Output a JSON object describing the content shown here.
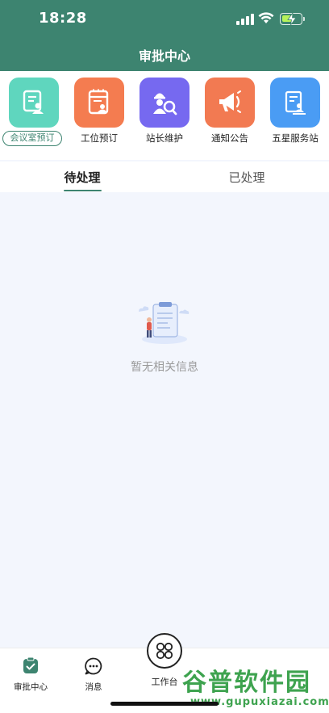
{
  "status_bar": {
    "time": "18:28"
  },
  "header": {
    "title": "审批中心"
  },
  "shortcuts": [
    {
      "label": "会议室预订",
      "icon": "meeting-room-icon",
      "color": "#5fd6be"
    },
    {
      "label": "工位预订",
      "icon": "workstation-icon",
      "color": "#f47c50"
    },
    {
      "label": "站长维护",
      "icon": "station-manager-icon",
      "color": "#7669f0"
    },
    {
      "label": "通知公告",
      "icon": "announcement-icon",
      "color": "#f27a52"
    },
    {
      "label": "五星服务站",
      "icon": "service-station-icon",
      "color": "#4a9cf4"
    }
  ],
  "tabs": [
    {
      "label": "待处理",
      "active": true
    },
    {
      "label": "已处理",
      "active": false
    }
  ],
  "empty_state": {
    "text": "暂无相关信息"
  },
  "bottom_nav": [
    {
      "label": "审批中心",
      "icon": "approval-icon"
    },
    {
      "label": "消息",
      "icon": "message-icon"
    },
    {
      "label": "工作台",
      "icon": "workbench-icon"
    }
  ],
  "watermark": {
    "main": "谷普软件园",
    "url": "www.gupuxiazai.com"
  },
  "colors": {
    "accent": "#3d8470"
  }
}
